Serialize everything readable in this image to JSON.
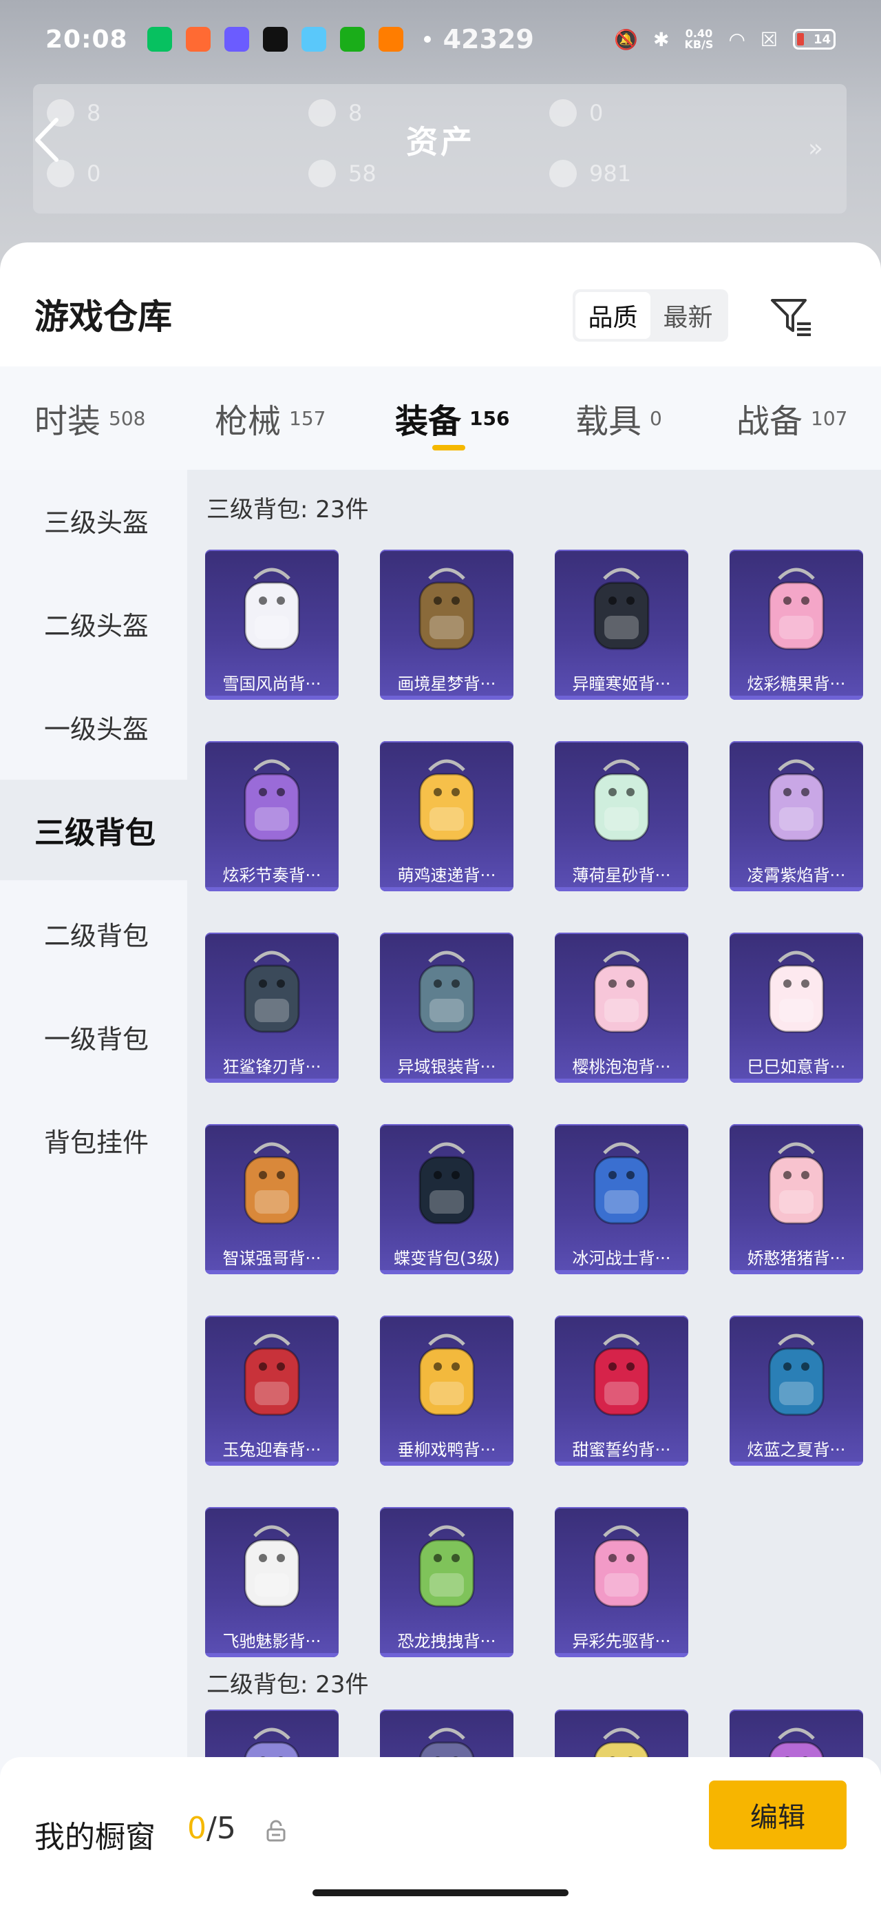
{
  "status_bar": {
    "time": "20:08",
    "steps": "42329",
    "net_speed_value": "0.40",
    "net_speed_unit": "KB/S",
    "battery": "14",
    "app_icon_colors": [
      "#07c160",
      "#ff6a33",
      "#6b5cff",
      "#111111",
      "#5ac8fa",
      "#1aad19",
      "#ff7d00"
    ]
  },
  "assets": {
    "title": "资产",
    "values": [
      "8",
      "8",
      "0",
      "0",
      "58",
      "981"
    ]
  },
  "warehouse": {
    "title": "游戏仓库",
    "sort_options": [
      {
        "label": "品质",
        "active": true
      },
      {
        "label": "最新",
        "active": false
      }
    ]
  },
  "tabs": [
    {
      "label": "时装",
      "count": "508",
      "active": false
    },
    {
      "label": "枪械",
      "count": "157",
      "active": false
    },
    {
      "label": "装备",
      "count": "156",
      "active": true
    },
    {
      "label": "载具",
      "count": "0",
      "active": false
    },
    {
      "label": "战备",
      "count": "107",
      "active": false
    }
  ],
  "sidebar": [
    {
      "label": "三级头盔",
      "active": false
    },
    {
      "label": "二级头盔",
      "active": false
    },
    {
      "label": "一级头盔",
      "active": false
    },
    {
      "label": "三级背包",
      "active": true
    },
    {
      "label": "二级背包",
      "active": false
    },
    {
      "label": "一级背包",
      "active": false
    },
    {
      "label": "背包挂件",
      "active": false
    }
  ],
  "sections": [
    {
      "title": "三级背包: 23件",
      "items": [
        "雪国风尚背···",
        "画境星梦背···",
        "异瞳寒姬背···",
        "炫彩糖果背···",
        "炫彩节奏背···",
        "萌鸡速递背···",
        "薄荷星砂背···",
        "凌霄紫焰背···",
        "狂鲨锋刃背···",
        "异域银装背···",
        "樱桃泡泡背···",
        "巳巳如意背···",
        "智谋强哥背···",
        "蝶变背包(3级)",
        "冰河战士背···",
        "娇憨猪猪背···",
        "玉兔迎春背···",
        "垂柳戏鸭背···",
        "甜蜜誓约背···",
        "炫蓝之夏背···",
        "飞驰魅影背···",
        "恐龙拽拽背···",
        "异彩先驱背···"
      ]
    },
    {
      "title": "二级背包: 23件",
      "items": [
        "",
        "",
        "",
        ""
      ]
    }
  ],
  "item_art_colors": [
    "#f2f2f8",
    "#8a6a3a",
    "#2a2f3a",
    "#f4a6c8",
    "#9a6bd8",
    "#f6c04a",
    "#cfeedd",
    "#c9a7e6",
    "#3b4a5a",
    "#5f7f8f",
    "#f7c6d9",
    "#fde9ef",
    "#d9883a",
    "#1d2a3a",
    "#3a6fd0",
    "#f8c3cf",
    "#c8323a",
    "#f3b93d",
    "#d6234a",
    "#2a7fb6",
    "#f2f2f2",
    "#7fc35a",
    "#f29ac7",
    "#8c86d8",
    "#6a6aa0",
    "#e8d26a",
    "#b66ad6"
  ],
  "bottom_bar": {
    "showcase_label": "我的橱窗",
    "showcase_current": "0",
    "showcase_total": "/5",
    "edit_label": "编辑"
  },
  "colors": {
    "accent": "#f5b800",
    "card_bg": "#4a3e98"
  }
}
